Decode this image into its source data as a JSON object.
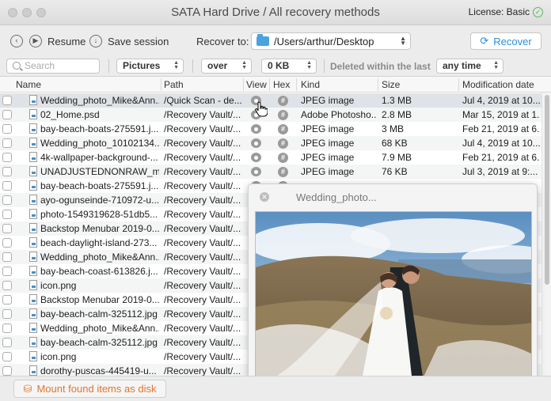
{
  "window": {
    "title": "SATA Hard Drive / All recovery methods",
    "license_label": "License: Basic"
  },
  "toolbar": {
    "resume_label": "Resume",
    "save_session_label": "Save session",
    "recover_to_label": "Recover to:",
    "recover_path": "/Users/arthur/Desktop",
    "recover_label": "Recover"
  },
  "filters": {
    "search_placeholder": "Search",
    "type_value": "Pictures",
    "size_op_value": "over",
    "size_value": "0 KB",
    "deleted_label": "Deleted within the last",
    "time_value": "any time"
  },
  "table": {
    "columns": [
      "Name",
      "Path",
      "View",
      "Hex",
      "Kind",
      "Size",
      "Modification date"
    ],
    "rows": [
      {
        "name": "Wedding_photo_Mike&Ann...",
        "path": "/Quick Scan - de...",
        "kind": "JPEG image",
        "size": "1.3 MB",
        "date": "Jul 4, 2019 at 10..."
      },
      {
        "name": "02_Home.psd",
        "path": "/Recovery Vault/...",
        "kind": "Adobe Photosho...",
        "size": "2.8 MB",
        "date": "Mar 15, 2019 at 1..."
      },
      {
        "name": "bay-beach-boats-275591.j...",
        "path": "/Recovery Vault/...",
        "kind": "JPEG image",
        "size": "3 MB",
        "date": "Feb 21, 2019 at 6..."
      },
      {
        "name": "Wedding_photo_10102134...",
        "path": "/Recovery Vault/...",
        "kind": "JPEG image",
        "size": "68 KB",
        "date": "Jul 4, 2019 at 10..."
      },
      {
        "name": "4k-wallpaper-background-...",
        "path": "/Recovery Vault/...",
        "kind": "JPEG image",
        "size": "7.9 MB",
        "date": "Feb 21, 2019 at 6..."
      },
      {
        "name": "UNADJUSTEDNONRAW_mi...",
        "path": "/Recovery Vault/...",
        "kind": "JPEG image",
        "size": "76 KB",
        "date": "Jul 3, 2019 at 9:..."
      },
      {
        "name": "bay-beach-boats-275591.j...",
        "path": "/Recovery Vault/...",
        "kind": "",
        "size": "",
        "date": ""
      },
      {
        "name": "ayo-ogunseinde-710972-u...",
        "path": "/Recovery Vault/...",
        "kind": "",
        "size": "",
        "date": ""
      },
      {
        "name": "photo-1549319628-51db5...",
        "path": "/Recovery Vault/...",
        "kind": "",
        "size": "",
        "date": ""
      },
      {
        "name": "Backstop Menubar 2019-0...",
        "path": "/Recovery Vault/...",
        "kind": "",
        "size": "",
        "date": ""
      },
      {
        "name": "beach-daylight-island-273...",
        "path": "/Recovery Vault/...",
        "kind": "",
        "size": "",
        "date": ""
      },
      {
        "name": "Wedding_photo_Mike&Ann...",
        "path": "/Recovery Vault/...",
        "kind": "",
        "size": "",
        "date": ""
      },
      {
        "name": "bay-beach-coast-613826.j...",
        "path": "/Recovery Vault/...",
        "kind": "",
        "size": "",
        "date": ""
      },
      {
        "name": "icon.png",
        "path": "/Recovery Vault/...",
        "kind": "",
        "size": "",
        "date": ""
      },
      {
        "name": "Backstop Menubar 2019-0...",
        "path": "/Recovery Vault/...",
        "kind": "",
        "size": "",
        "date": ""
      },
      {
        "name": "bay-beach-calm-325112.jpg",
        "path": "/Recovery Vault/...",
        "kind": "",
        "size": "",
        "date": ""
      },
      {
        "name": "Wedding_photo_Mike&Ann...",
        "path": "/Recovery Vault/...",
        "kind": "",
        "size": "",
        "date": ""
      },
      {
        "name": "bay-beach-calm-325112.jpg",
        "path": "/Recovery Vault/...",
        "kind": "",
        "size": "",
        "date": ""
      },
      {
        "name": "icon.png",
        "path": "/Recovery Vault/...",
        "kind": "",
        "size": "",
        "date": ""
      },
      {
        "name": "dorothy-puscas-445419-u...",
        "path": "/Recovery Vault/...",
        "kind": "",
        "size": "",
        "date": ""
      }
    ]
  },
  "preview": {
    "title": "Wedding_photo..."
  },
  "bottom": {
    "mount_label": "Mount found items as disk"
  },
  "icons": {
    "back": "back-icon",
    "resume": "play-icon",
    "save": "download-icon",
    "folder": "folder-icon",
    "recover": "refresh-icon",
    "search": "search-icon",
    "view": "eye-icon",
    "hex": "hash-icon",
    "mount": "disk-icon",
    "license": "check-circle-icon"
  },
  "colors": {
    "accent": "#2a8fd8",
    "mount": "#e2762b",
    "license_check": "#5cb85c"
  }
}
